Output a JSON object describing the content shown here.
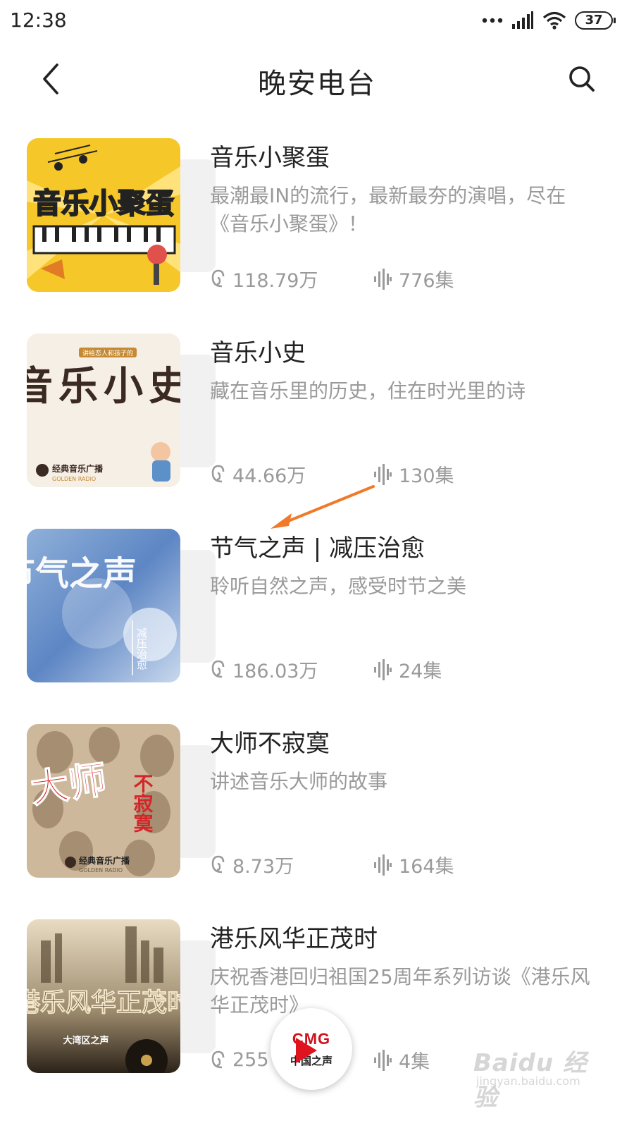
{
  "status_bar": {
    "time": "12:38",
    "battery": "37",
    "icons": [
      "dots-icon",
      "signal-icon",
      "wifi-icon",
      "battery-icon"
    ]
  },
  "header": {
    "title": "晚安电台",
    "back_icon": "back-arrow-icon",
    "search_icon": "search-icon"
  },
  "items": [
    {
      "title": "音乐小聚蛋",
      "description": "最潮最IN的流行，最新最夯的演唱，尽在《音乐小聚蛋》！",
      "listens": "118.79万",
      "episodes": "776集",
      "cover_text": "音乐小聚蛋"
    },
    {
      "title": "音乐小史",
      "description": "藏在音乐里的历史，住在时光里的诗",
      "listens": "44.66万",
      "episodes": "130集",
      "cover_text": "音乐小史",
      "cover_tag": "讲给恋人和孩子的",
      "cover_brand": "经典音乐广播",
      "cover_brand_en": "GOLDEN RADIO"
    },
    {
      "title": "节气之声 | 减压治愈",
      "description": "聆听自然之声，感受时节之美",
      "listens": "186.03万",
      "episodes": "24集",
      "cover_text": "节气之声",
      "cover_sub": "减压治愈"
    },
    {
      "title": "大师不寂寞",
      "description": "讲述音乐大师的故事",
      "listens": "8.73万",
      "episodes": "164集",
      "cover_text": "大师",
      "cover_text2": "不寂寞",
      "cover_brand": "经典音乐广播",
      "cover_brand_en": "GOLDEN RADIO"
    },
    {
      "title": "港乐风华正茂时",
      "description": "庆祝香港回归祖国25周年系列访谈《港乐风华正茂时》",
      "listens": "255",
      "episodes": "4集",
      "cover_text": "港乐风华正茂时",
      "cover_sub": "大湾区之声"
    }
  ],
  "player": {
    "brand": "CMG",
    "channel": "中国之声"
  },
  "annotation": {
    "arrow_color": "#f07a2a"
  },
  "watermark": {
    "text": "Baidu 经验",
    "url": "jingyan.baidu.com"
  },
  "colors": {
    "text_primary": "#222222",
    "text_secondary": "#9a9a9a",
    "accent": "#d0101c"
  }
}
